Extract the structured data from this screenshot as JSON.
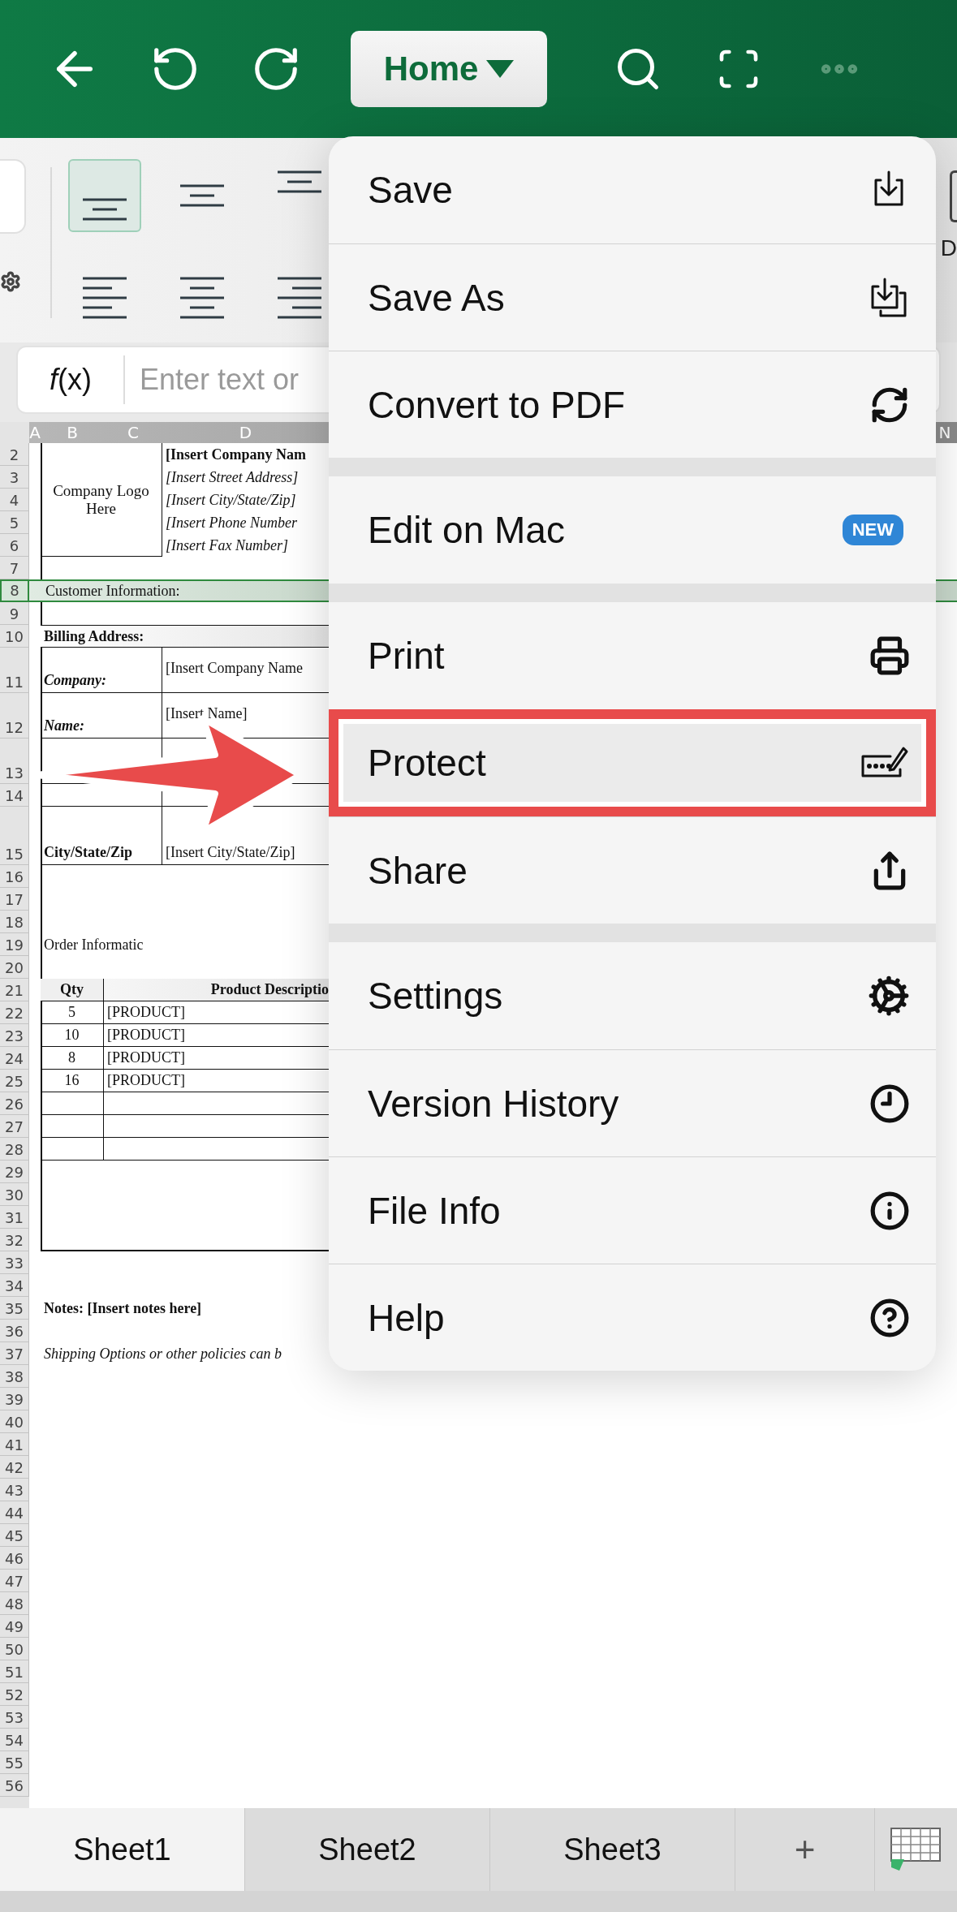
{
  "toolbar": {
    "tab_button": "Home"
  },
  "ribbon": {
    "align_buttons": [
      {
        "selected": true
      },
      {
        "selected": false
      },
      {
        "selected": false
      },
      {
        "selected": false
      },
      {
        "selected": false
      },
      {
        "selected": false
      }
    ],
    "side_label": "D"
  },
  "formula_bar": {
    "fx_label": "*f*(x)",
    "placeholder": "Enter text or"
  },
  "sheet": {
    "columns": [
      "A",
      "B",
      "C",
      "D",
      "N"
    ],
    "rows": [
      "2",
      "3",
      "4",
      "5",
      "6",
      "7",
      "8",
      "9",
      "10",
      "11",
      "12",
      "13",
      "14",
      "15",
      "16",
      "17",
      "18",
      "19",
      "20",
      "21",
      "22",
      "23",
      "24",
      "25",
      "26",
      "27",
      "28",
      "29",
      "30",
      "31",
      "32",
      "33",
      "34",
      "35",
      "36",
      "37",
      "38",
      "39",
      "40",
      "41",
      "42",
      "43",
      "44",
      "45",
      "46",
      "47",
      "48",
      "49",
      "50",
      "51",
      "52",
      "53",
      "54",
      "55",
      "56"
    ],
    "logo": "Company Logo Here",
    "company_lines": [
      "[Insert Company Nam",
      "[Insert Street Address]",
      "[Insert City/State/Zip]",
      "[Insert Phone Number",
      "[Insert Fax Number]"
    ],
    "customer_info": {
      "text": "Customer Information:",
      "selected": true
    },
    "billing_title": "Billing Address:",
    "billing_fields": [
      {
        "label": "Company:",
        "value": "[Insert Company Name"
      },
      {
        "label": "Name:",
        "value": "[Insert Name]"
      },
      {
        "label": "City/State/Zip",
        "value": "[Insert City/State/Zip]"
      }
    ],
    "order_title": "Order Informatic",
    "order_columns": [
      "Qty",
      "Product Descriptio"
    ],
    "order_rows": [
      {
        "qty": "5",
        "product": "[PRODUCT]"
      },
      {
        "qty": "10",
        "product": "[PRODUCT]"
      },
      {
        "qty": "8",
        "product": "[PRODUCT]"
      },
      {
        "qty": "16",
        "product": "[PRODUCT]"
      }
    ],
    "notes": "Notes: [Insert notes here]",
    "shipping": "Shipping Options or other policies can b"
  },
  "sheet_tabs": [
    {
      "label": "Sheet1",
      "selected": true
    },
    {
      "label": "Sheet2",
      "selected": false
    },
    {
      "label": "Sheet3",
      "selected": false
    }
  ],
  "add_sheet": "+",
  "menu": {
    "sections": [
      {
        "items": [
          {
            "label": "Save",
            "highlighted": false
          },
          {
            "label": "Save As",
            "highlighted": false
          },
          {
            "label": "Convert to PDF",
            "highlighted": false
          }
        ]
      },
      {
        "items": [
          {
            "label": "Edit on Mac",
            "highlighted": false,
            "badge": "NEW"
          }
        ]
      },
      {
        "items": [
          {
            "label": "Print",
            "highlighted": false
          },
          {
            "label": "Protect",
            "highlighted": true
          },
          {
            "label": "Share",
            "highlighted": false
          }
        ]
      },
      {
        "items": [
          {
            "label": "Settings",
            "highlighted": false
          },
          {
            "label": "Version History",
            "highlighted": false
          },
          {
            "label": "File Info",
            "highlighted": false
          },
          {
            "label": "Help",
            "highlighted": false
          }
        ]
      }
    ]
  }
}
